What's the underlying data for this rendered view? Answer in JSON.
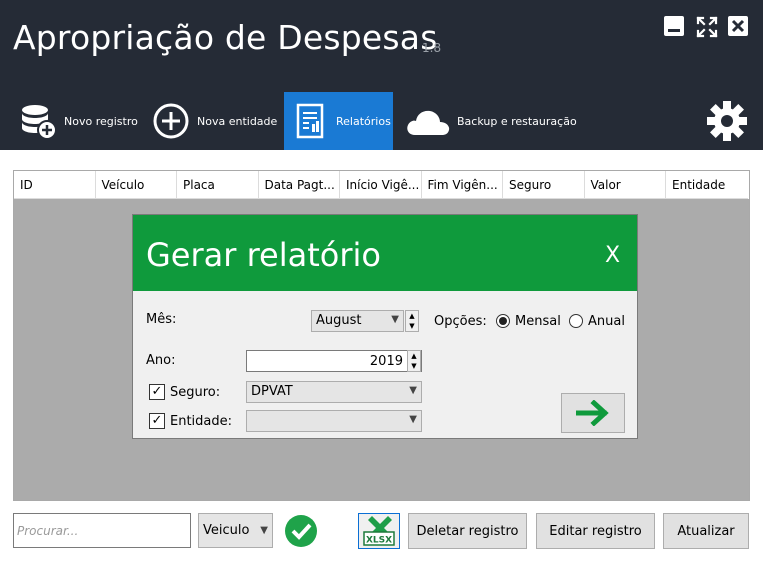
{
  "app": {
    "title": "Apropriação de Despesas",
    "version": "1.8"
  },
  "tabs": [
    {
      "label": "Novo registro",
      "icon": "database-add-icon"
    },
    {
      "label": "Nova entidade",
      "icon": "plus-circle-icon"
    },
    {
      "label": "Relatórios",
      "icon": "report-icon"
    },
    {
      "label": "Backup e restauração",
      "icon": "cloud-icon"
    }
  ],
  "active_tab": "Relatórios",
  "table": {
    "columns": [
      "ID",
      "Veículo",
      "Placa",
      "Data Pagt...",
      "Início Vigê...",
      "Fim Vigên...",
      "Seguro",
      "Valor",
      "Entidade"
    ]
  },
  "dialog": {
    "title": "Gerar relatório",
    "close": "X",
    "mes_label": "Mês:",
    "mes_value": "August",
    "opcoes_label": "Opções:",
    "opt_mensal": "Mensal",
    "opt_anual": "Anual",
    "selected_option": "Mensal",
    "ano_label": "Ano:",
    "ano_value": "2019",
    "seguro_label": "Seguro:",
    "seguro_checked": true,
    "seguro_value": "DPVAT",
    "entidade_label": "Entidade:",
    "entidade_checked": true,
    "entidade_value": ""
  },
  "footer": {
    "search_placeholder": "Procurar...",
    "filter_value": "Veiculo",
    "xlsx_label": "XLSX",
    "delete_label": "Deletar registro",
    "edit_label": "Editar registro",
    "refresh_label": "Atualizar"
  },
  "colors": {
    "titlebar": "#252b36",
    "active_tab": "#1a7ad4",
    "dialog_header": "#0f9a3c",
    "ok_green": "#1fa34a"
  }
}
